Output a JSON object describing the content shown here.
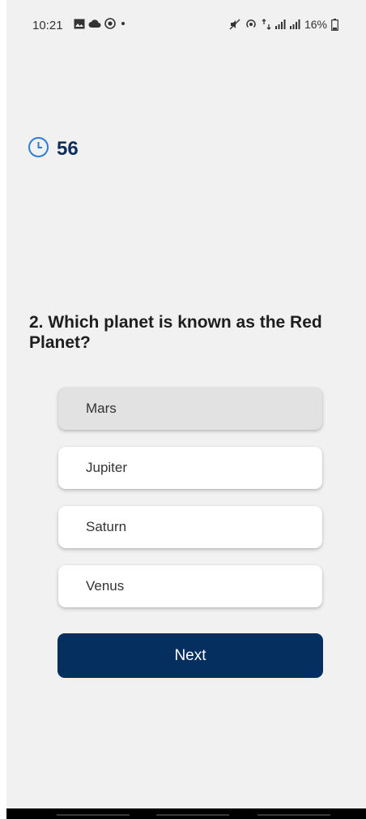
{
  "status_bar": {
    "time": "10:21",
    "battery": "16%",
    "left_icons": [
      "gallery-icon",
      "cloud-icon",
      "record-icon",
      "dot-icon"
    ],
    "right_icons": [
      "mute-icon",
      "hotspot-icon",
      "data-icon",
      "signal-icon",
      "signal-icon",
      "battery-icon"
    ]
  },
  "timer": {
    "icon": "clock-icon",
    "value": "56"
  },
  "question": {
    "text": "2. Which planet is known as the Red Planet?"
  },
  "options": [
    {
      "label": "Mars",
      "selected": true
    },
    {
      "label": "Jupiter",
      "selected": false
    },
    {
      "label": "Saturn",
      "selected": false
    },
    {
      "label": "Venus",
      "selected": false
    }
  ],
  "next_button": {
    "label": "Next"
  },
  "colors": {
    "accent": "#052f5f",
    "timer_icon": "#2a7fd4",
    "background": "#f1f1f1",
    "selected_option": "#e2e2e2"
  }
}
